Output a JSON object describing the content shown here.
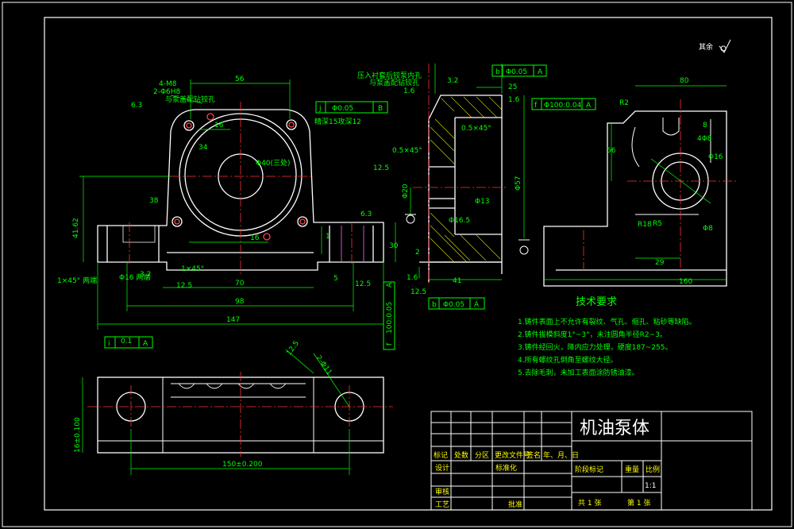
{
  "drawing": {
    "part_name": "机油泵体",
    "roughness_note": "其余",
    "scale_label": "比例",
    "scale_value": "1:1",
    "sheet_total": "共 1 张",
    "sheet_index": "第 1 张"
  },
  "title_block": {
    "row1": [
      "标记",
      "处数",
      "分区",
      "更改文件号",
      "签名",
      "年、月、日"
    ],
    "designer": "设计",
    "standardize": "标准化",
    "stage_mark": "阶段标记",
    "weight": "重量",
    "review": "审核",
    "process": "工艺",
    "approve": "批准"
  },
  "tech_req": {
    "title": "技术要求",
    "items": [
      "1.铸件表面上不允许有裂纹、气孔、缩孔、粘砂等缺陷。",
      "2.铸件拔模斜度1°~3°，未注圆角半径R2~3。",
      "3.铸件经回火，降内应力处理，硬度187~255。",
      "4.所有螺纹孔倒角至螺纹大径。",
      "5.去除毛刺，未加工表面涂防锈油漆。"
    ]
  },
  "front_view": {
    "dims": [
      "56",
      "16",
      "34",
      "4-M8",
      "2-Φ6H8",
      "Φ40(三处)",
      "38",
      "41.62",
      "16",
      "6.3",
      "1",
      "30",
      "70",
      "98",
      "147",
      "5",
      "1×45°",
      "1×45° 两端",
      "Φ16 两端",
      "3.2",
      "12.5",
      "12.5",
      "6.3",
      "0.1"
    ],
    "note_pin": "与泵盖配钻铰孔",
    "note_thread": "精深15攻深12",
    "ftol_j": [
      "j",
      "Φ0.05",
      "B"
    ],
    "ftol_i": [
      "i",
      "0.1",
      "A"
    ],
    "ftol_f": [
      "f",
      "100:0.05",
      "A"
    ],
    "ftol_b": [
      "b",
      "Φ0.05",
      "A"
    ]
  },
  "section_view": {
    "note_press": "压入衬套后铰泵内孔",
    "note_press2": "与泵盖配钻铰孔",
    "dims": [
      "25",
      "1.6",
      "1.6",
      "0.5×45°",
      "0.5×45°",
      "12.5",
      "3.2",
      "Φ13",
      "Φ16.5",
      "Φ57",
      "41",
      "Φ20",
      "2",
      "Φ16.5",
      "12.5",
      "1.6"
    ],
    "ftol_b2": [
      "b",
      "Φ0.05",
      "A"
    ],
    "ftol_f2": [
      "f",
      "Φ100:0.04",
      "A"
    ],
    "ftol_b3": [
      "b",
      "Φ0.05",
      "A"
    ]
  },
  "side_view": {
    "dims": [
      "80",
      "R2",
      "56",
      "8",
      "4Φ8",
      "Φ16",
      "R18",
      "R5",
      "29",
      "160",
      "Φ8"
    ]
  },
  "bottom_view": {
    "dims": [
      "150±0.200",
      "16±0.100",
      "12.5",
      "2-Φ11",
      "Φ6.3"
    ]
  }
}
